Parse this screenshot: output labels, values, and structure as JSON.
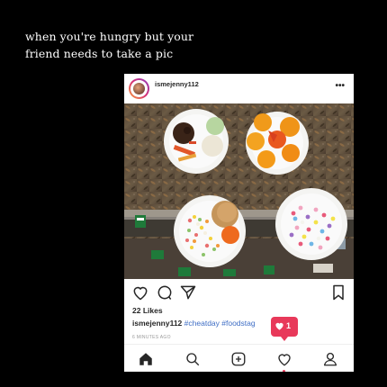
{
  "caption": {
    "line1": "when you're hungry but your",
    "line2": "friend needs to take a pic"
  },
  "post": {
    "username": "ismejenny112",
    "more_label": "•••",
    "likes": "22 Likes",
    "caption_user": "ismejenny112",
    "caption_tags": "#cheatday #foodstag",
    "timestamp": "6 MINUTES AGO"
  },
  "notification": {
    "count": "1",
    "color": "#e8395a"
  },
  "icons": {
    "actions": [
      "heart-icon",
      "comment-icon",
      "share-icon",
      "bookmark-icon"
    ],
    "nav": [
      "home-icon",
      "search-icon",
      "add-post-icon",
      "activity-heart-icon",
      "profile-icon"
    ]
  }
}
